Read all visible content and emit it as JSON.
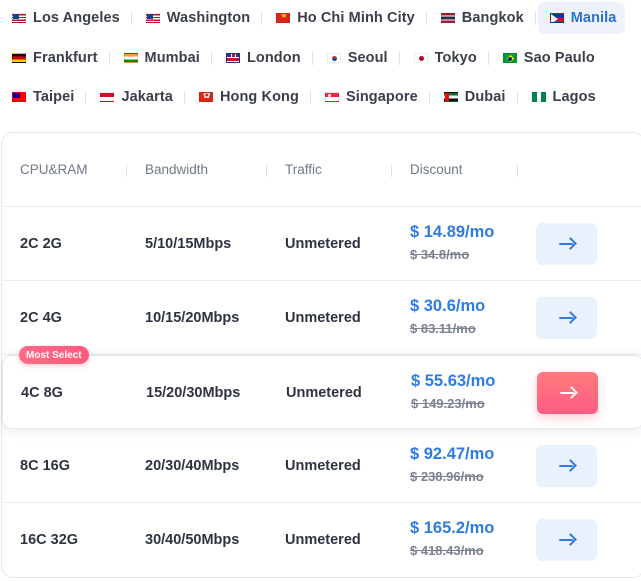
{
  "locations": [
    [
      {
        "label": "Los Angeles",
        "flag": "us-flag-icon"
      },
      {
        "label": "Washington",
        "flag": "us-flag-icon"
      },
      {
        "label": "Ho Chi Minh City",
        "flag": "vietnam-flag-icon"
      },
      {
        "label": "Bangkok",
        "flag": "thailand-flag-icon"
      },
      {
        "label": "Manila",
        "flag": "philippines-flag-icon",
        "active": true
      }
    ],
    [
      {
        "label": "Frankfurt",
        "flag": "germany-flag-icon"
      },
      {
        "label": "Mumbai",
        "flag": "india-flag-icon"
      },
      {
        "label": "London",
        "flag": "uk-flag-icon"
      },
      {
        "label": "Seoul",
        "flag": "korea-flag-icon"
      },
      {
        "label": "Tokyo",
        "flag": "japan-flag-icon"
      },
      {
        "label": "Sao Paulo",
        "flag": "brazil-flag-icon"
      }
    ],
    [
      {
        "label": "Taipei",
        "flag": "taiwan-flag-icon"
      },
      {
        "label": "Jakarta",
        "flag": "indonesia-flag-icon"
      },
      {
        "label": "Hong Kong",
        "flag": "hongkong-flag-icon"
      },
      {
        "label": "Singapore",
        "flag": "singapore-flag-icon"
      },
      {
        "label": "Dubai",
        "flag": "uae-flag-icon"
      },
      {
        "label": "Lagos",
        "flag": "nigeria-flag-icon"
      }
    ]
  ],
  "table": {
    "headers": {
      "cpu": "CPU&RAM",
      "bandwidth": "Bandwidth",
      "traffic": "Traffic",
      "discount": "Discount"
    },
    "badge": "Most Select",
    "rows": [
      {
        "cpu": "2C 2G",
        "bandwidth": "5/10/15Mbps",
        "traffic": "Unmetered",
        "price": "$ 14.89/mo",
        "old_price": "$ 34.8/mo"
      },
      {
        "cpu": "2C 4G",
        "bandwidth": "10/15/20Mbps",
        "traffic": "Unmetered",
        "price": "$ 30.6/mo",
        "old_price": "$ 83.11/mo"
      },
      {
        "cpu": "4C 8G",
        "bandwidth": "15/20/30Mbps",
        "traffic": "Unmetered",
        "price": "$ 55.63/mo",
        "old_price": "$ 149.23/mo",
        "featured": true
      },
      {
        "cpu": "8C 16G",
        "bandwidth": "20/30/40Mbps",
        "traffic": "Unmetered",
        "price": "$ 92.47/mo",
        "old_price": "$ 238.96/mo"
      },
      {
        "cpu": "16C 32G",
        "bandwidth": "30/40/50Mbps",
        "traffic": "Unmetered",
        "price": "$ 165.2/mo",
        "old_price": "$ 418.43/mo"
      }
    ]
  },
  "colors": {
    "accent": "#2f7be6",
    "hot": "#ff5b85",
    "active_tab_bg": "#eef3fb"
  }
}
